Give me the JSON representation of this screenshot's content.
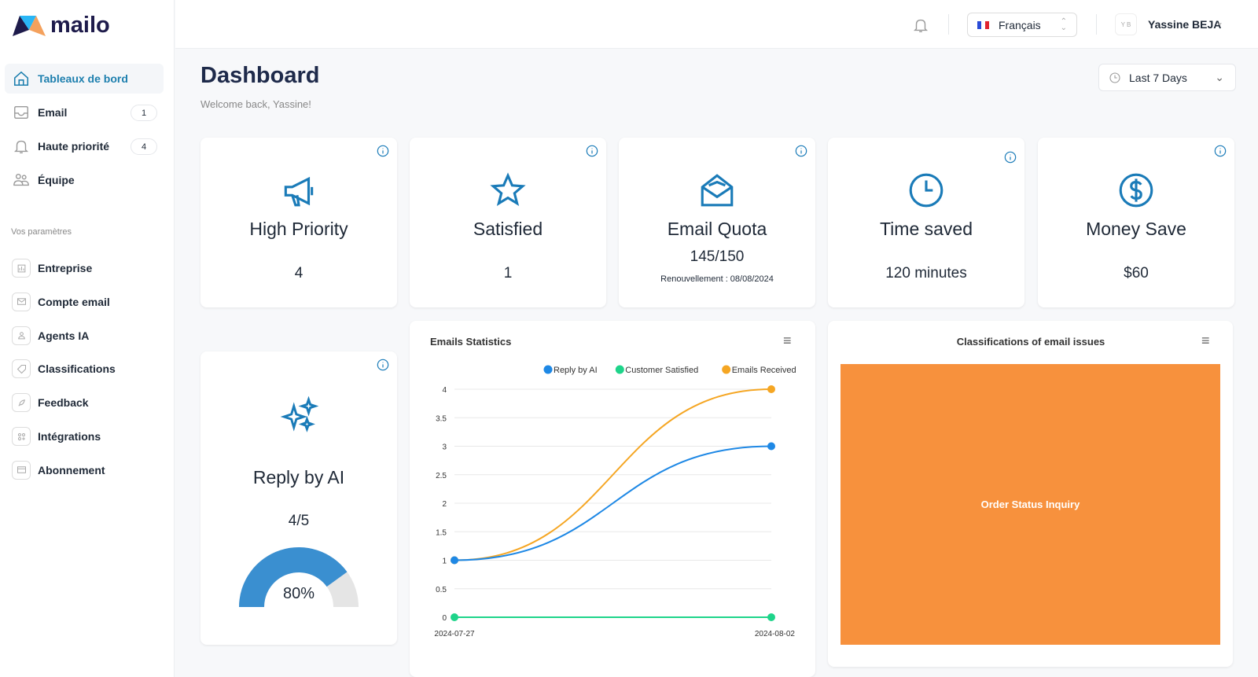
{
  "app": {
    "logo_text": "mailo"
  },
  "sidebar": {
    "items": [
      {
        "label": "Tableaux de bord",
        "icon": "home-icon",
        "active": true
      },
      {
        "label": "Email",
        "icon": "inbox-icon",
        "badge": "1"
      },
      {
        "label": "Haute priorité",
        "icon": "bell-icon",
        "badge": "4"
      },
      {
        "label": "Équipe",
        "icon": "users-icon"
      }
    ],
    "section_label": "Vos paramètres",
    "settings": [
      {
        "label": "Entreprise",
        "icon": "building-icon"
      },
      {
        "label": "Compte email",
        "icon": "mail-icon"
      },
      {
        "label": "Agents IA",
        "icon": "user-icon"
      },
      {
        "label": "Classifications",
        "icon": "tag-icon"
      },
      {
        "label": "Feedback",
        "icon": "rocket-icon"
      },
      {
        "label": "Intégrations",
        "icon": "grid-icon"
      },
      {
        "label": "Abonnement",
        "icon": "card-icon"
      }
    ]
  },
  "header": {
    "language": "Français",
    "user_initials": "Y B",
    "user_name": "Yassine BEJA"
  },
  "page": {
    "title": "Dashboard",
    "subtitle": "Welcome back, Yassine!",
    "date_range": "Last 7 Days"
  },
  "stats": [
    {
      "title": "High Priority",
      "value": "4"
    },
    {
      "title": "Satisfied",
      "value": "1"
    },
    {
      "title": "Email Quota",
      "value": "145/150",
      "note": "Renouvellement : 08/08/2024"
    },
    {
      "title": "Time saved",
      "value": "120 minutes"
    },
    {
      "title": "Money Save",
      "value": "$60"
    }
  ],
  "reply_ai": {
    "title": "Reply by AI",
    "value": "4/5",
    "percent_label": "80%",
    "percent": 80
  },
  "colors": {
    "accent": "#1a7bb8",
    "gauge": "#3a8fd0",
    "treemap": "#f7913d"
  },
  "chart_data": [
    {
      "type": "line",
      "title": "Emails Statistics",
      "x": [
        "2024-07-27",
        "2024-08-02"
      ],
      "ylim": [
        0,
        4
      ],
      "yticks": [
        "0",
        "0.5",
        "1",
        "1.5",
        "2",
        "2.5",
        "3",
        "3.5",
        "4"
      ],
      "legend": "top-right",
      "grid": true,
      "series": [
        {
          "name": "Reply by AI",
          "values": [
            1,
            3
          ],
          "color": "#1e88e5"
        },
        {
          "name": "Customer Satisfied",
          "values": [
            0,
            0
          ],
          "color": "#1ed48a"
        },
        {
          "name": "Emails Received",
          "values": [
            1,
            4
          ],
          "color": "#f5a623"
        }
      ]
    },
    {
      "type": "treemap",
      "title": "Classifications of email issues",
      "categories": [
        "Order Status Inquiry"
      ],
      "values": [
        1
      ]
    }
  ]
}
